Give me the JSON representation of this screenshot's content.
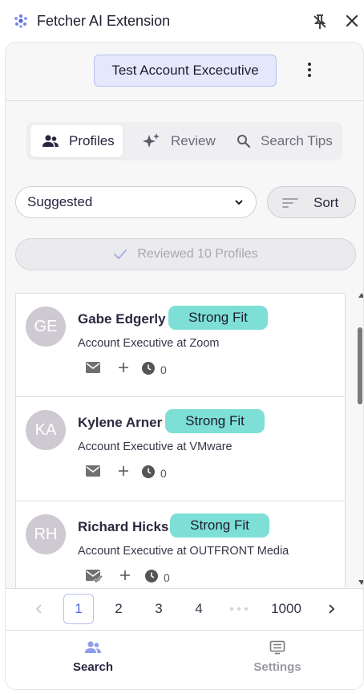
{
  "app": {
    "title": "Fetcher AI Extension"
  },
  "header": {
    "account_label": "Test Account Excecutive"
  },
  "tabs": [
    {
      "label": "Profiles",
      "icon": "people-icon",
      "active": true
    },
    {
      "label": "Review",
      "icon": "sparkle-icon",
      "active": false
    },
    {
      "label": "Search Tips",
      "icon": "search-icon",
      "active": false
    }
  ],
  "filters": {
    "selected": "Suggested",
    "sort_label": "Sort"
  },
  "reviewed": {
    "label": "Reviewed 10 Profiles"
  },
  "profiles": [
    {
      "initials": "GE",
      "name": "Gabe Edgerly",
      "fit": "Strong Fit",
      "role": "Account Executive at Zoom",
      "count": "0",
      "email_state": "mail-icon"
    },
    {
      "initials": "KA",
      "name": "Kylene Arner",
      "fit": "Strong Fit",
      "role": "Account Executive at VMware",
      "count": "0",
      "email_state": "mail-icon"
    },
    {
      "initials": "RH",
      "name": "Richard Hicks",
      "fit": "Strong Fit",
      "role": "Account Executive at OUTFRONT Media",
      "count": "0",
      "email_state": "mail-check-icon"
    }
  ],
  "pagination": {
    "pages": [
      "1",
      "2",
      "3",
      "4"
    ],
    "last": "1000",
    "current": "1"
  },
  "nav": {
    "search": "Search",
    "settings": "Settings"
  },
  "colors": {
    "accent": "#5566d8",
    "fit_badge": "#7ddfd6",
    "account_chip": "#e5e8fb",
    "avatar": "#cfc9d2"
  }
}
